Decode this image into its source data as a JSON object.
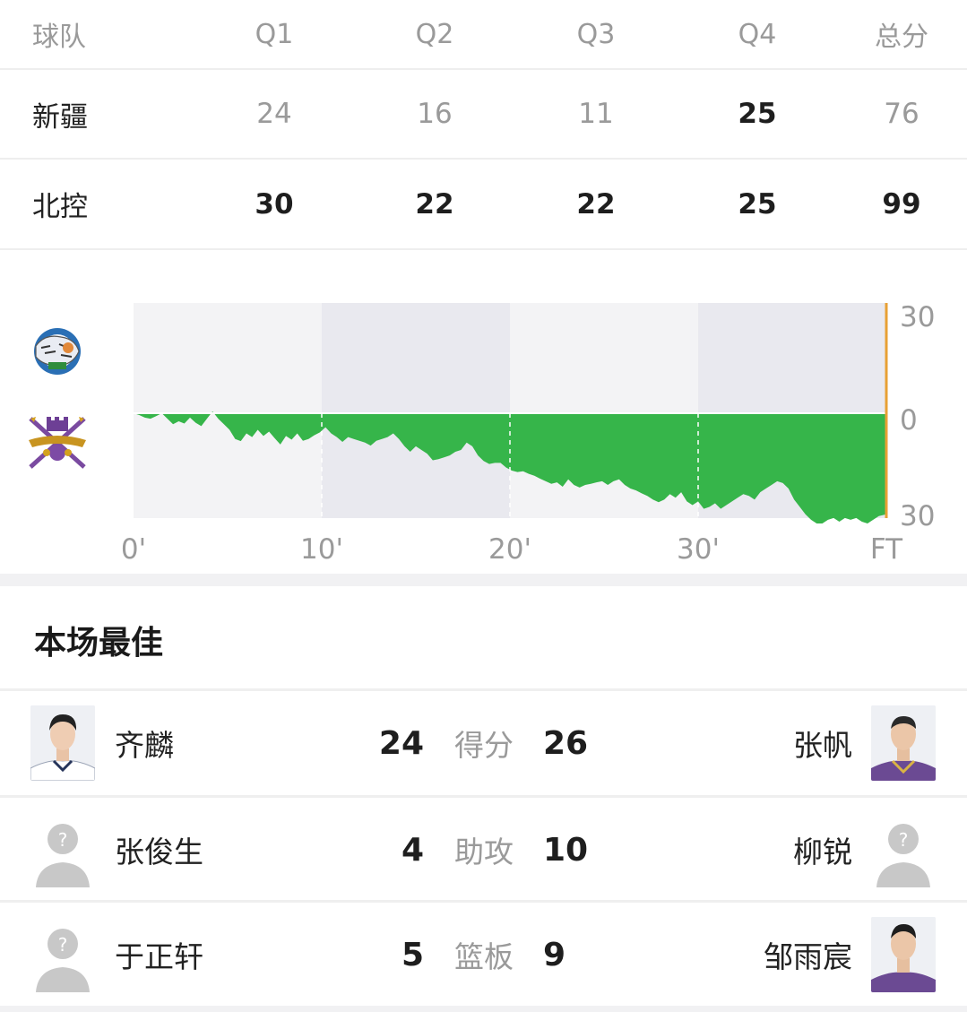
{
  "score_table": {
    "headers": [
      "球队",
      "Q1",
      "Q2",
      "Q3",
      "Q4",
      "总分"
    ],
    "rows": [
      {
        "team": "新疆",
        "scores": [
          "24",
          "16",
          "11",
          "25",
          "76"
        ],
        "bold": [
          false,
          false,
          false,
          true,
          false
        ]
      },
      {
        "team": "北控",
        "scores": [
          "30",
          "22",
          "22",
          "25",
          "99"
        ],
        "bold": [
          true,
          true,
          true,
          true,
          true
        ]
      }
    ]
  },
  "chart_data": {
    "type": "area",
    "x_tick_labels": [
      "0'",
      "10'",
      "20'",
      "30'",
      "FT"
    ],
    "y_tick_labels": [
      "30",
      "0",
      "30"
    ],
    "x_range": [
      0,
      40
    ],
    "y_range": [
      -30,
      30
    ],
    "fill_color": "#36b54a",
    "end_line_color": "#e8a135",
    "series": {
      "x": [
        0,
        0.3,
        0.6,
        0.9,
        1.2,
        1.5,
        1.8,
        2.1,
        2.4,
        2.7,
        3.0,
        3.3,
        3.6,
        3.9,
        4.2,
        4.5,
        4.8,
        5.1,
        5.4,
        5.7,
        6.0,
        6.3,
        6.6,
        6.9,
        7.2,
        7.5,
        7.8,
        8.1,
        8.4,
        8.7,
        9.0,
        9.3,
        9.6,
        9.9,
        10.2,
        10.5,
        10.8,
        11.1,
        11.4,
        11.7,
        12.0,
        12.3,
        12.6,
        12.9,
        13.2,
        13.5,
        13.8,
        14.1,
        14.4,
        14.7,
        15.0,
        15.3,
        15.6,
        15.9,
        16.2,
        16.5,
        16.8,
        17.1,
        17.4,
        17.7,
        18.0,
        18.3,
        18.6,
        18.9,
        19.2,
        19.5,
        19.8,
        20.1,
        20.4,
        20.7,
        21.0,
        21.3,
        21.6,
        21.9,
        22.2,
        22.5,
        22.8,
        23.1,
        23.4,
        23.7,
        24.0,
        24.3,
        24.6,
        24.9,
        25.2,
        25.5,
        25.8,
        26.1,
        26.4,
        26.7,
        27.0,
        27.3,
        27.6,
        27.9,
        28.2,
        28.5,
        28.8,
        29.1,
        29.4,
        29.7,
        30.0,
        30.3,
        30.6,
        30.9,
        31.2,
        31.5,
        31.8,
        32.1,
        32.4,
        32.7,
        33.0,
        33.3,
        33.6,
        33.9,
        34.2,
        34.5,
        34.8,
        35.1,
        35.4,
        35.7,
        36.0,
        36.3,
        36.6,
        36.9,
        37.2,
        37.5,
        37.8,
        38.1,
        38.4,
        38.7,
        39.0,
        39.3,
        39.6,
        40.0
      ],
      "y": [
        0,
        -0.5,
        -1.2,
        -1.5,
        -0.8,
        0,
        -1.5,
        -3,
        -2.2,
        -2.8,
        -1.2,
        -2.6,
        -3.5,
        -1.5,
        0.5,
        -1.5,
        -3,
        -4.5,
        -7,
        -7.6,
        -5.5,
        -6.5,
        -4.5,
        -6.2,
        -5,
        -6.8,
        -8.5,
        -6.2,
        -7.2,
        -5.5,
        -7.5,
        -7,
        -6,
        -5.2,
        -3.8,
        -5.5,
        -6.5,
        -7.8,
        -6.5,
        -7,
        -7.5,
        -8,
        -8.8,
        -7.5,
        -7,
        -6.5,
        -5.5,
        -7,
        -9,
        -10.5,
        -9,
        -10,
        -11,
        -12.8,
        -12.5,
        -12,
        -11.5,
        -10.5,
        -10,
        -8,
        -9,
        -11.5,
        -13,
        -13.8,
        -13.5,
        -13.5,
        -14.8,
        -15.6,
        -16,
        -15.8,
        -16.5,
        -17,
        -17.8,
        -18.5,
        -19.2,
        -18.8,
        -20,
        -18,
        -19.5,
        -20.2,
        -19.5,
        -19.2,
        -18.8,
        -18.5,
        -19.5,
        -18.5,
        -18,
        -19.5,
        -20.5,
        -21,
        -21.8,
        -22.5,
        -23.5,
        -24.2,
        -23.5,
        -22,
        -23,
        -21.5,
        -24,
        -25,
        -24,
        -26,
        -25.5,
        -24.5,
        -26,
        -25,
        -24,
        -23,
        -22,
        -22.5,
        -23.5,
        -21.5,
        -20.5,
        -19.5,
        -18.5,
        -19,
        -20.5,
        -23.5,
        -25.5,
        -27.5,
        -29,
        -30,
        -30,
        -29,
        -28.5,
        -29.5,
        -28.5,
        -29,
        -28.5,
        -29.5,
        -30,
        -29,
        -28,
        -27.5,
        -26.5,
        -26.8,
        -25.8,
        -25,
        -24,
        -25.5,
        -29.5
      ]
    }
  },
  "best_players": {
    "title": "本场最佳",
    "rows": [
      {
        "left_name": "齐麟",
        "left_value": "24",
        "label": "得分",
        "right_value": "26",
        "right_name": "张帆",
        "left_avatar": "photo",
        "right_avatar": "photo"
      },
      {
        "left_name": "张俊生",
        "left_value": "4",
        "label": "助攻",
        "right_value": "10",
        "right_name": "柳锐",
        "left_avatar": "placeholder",
        "right_avatar": "placeholder"
      },
      {
        "left_name": "于正轩",
        "left_value": "5",
        "label": "篮板",
        "right_value": "9",
        "right_name": "邹雨宸",
        "left_avatar": "placeholder",
        "right_avatar": "photo"
      }
    ]
  },
  "icons": {
    "home_logo": "xinjiang-tigers-logo-icon",
    "away_logo": "beikong-royal-fighters-logo-icon",
    "placeholder": "question-person-icon"
  }
}
